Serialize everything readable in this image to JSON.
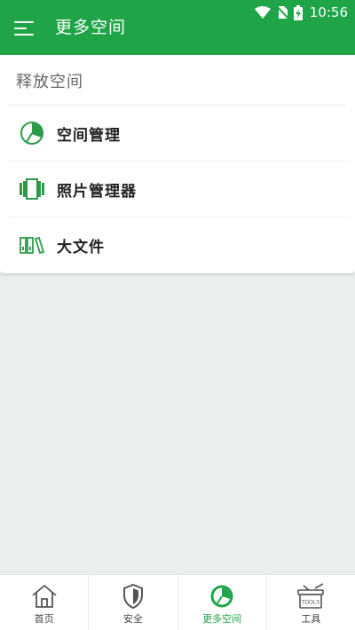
{
  "status_bar": {
    "time": "10:56"
  },
  "header": {
    "title": "更多空间",
    "menu_icon": "menu-icon"
  },
  "section": {
    "title": "释放空间",
    "items": [
      {
        "label": "空间管理",
        "icon": "pie-chart-icon"
      },
      {
        "label": "照片管理器",
        "icon": "photo-stack-icon"
      },
      {
        "label": "大文件",
        "icon": "binders-icon"
      }
    ]
  },
  "bottom_nav": {
    "items": [
      {
        "label": "首页",
        "icon": "home-icon"
      },
      {
        "label": "安全",
        "icon": "shield-icon"
      },
      {
        "label": "更多空间",
        "icon": "pie-chart-icon",
        "active": true
      },
      {
        "label": "工具",
        "icon": "toolbox-icon",
        "icon_text": "TOOLS"
      }
    ]
  },
  "colors": {
    "accent": "#1fa548",
    "background": "#eaeeed",
    "card": "#ffffff"
  }
}
